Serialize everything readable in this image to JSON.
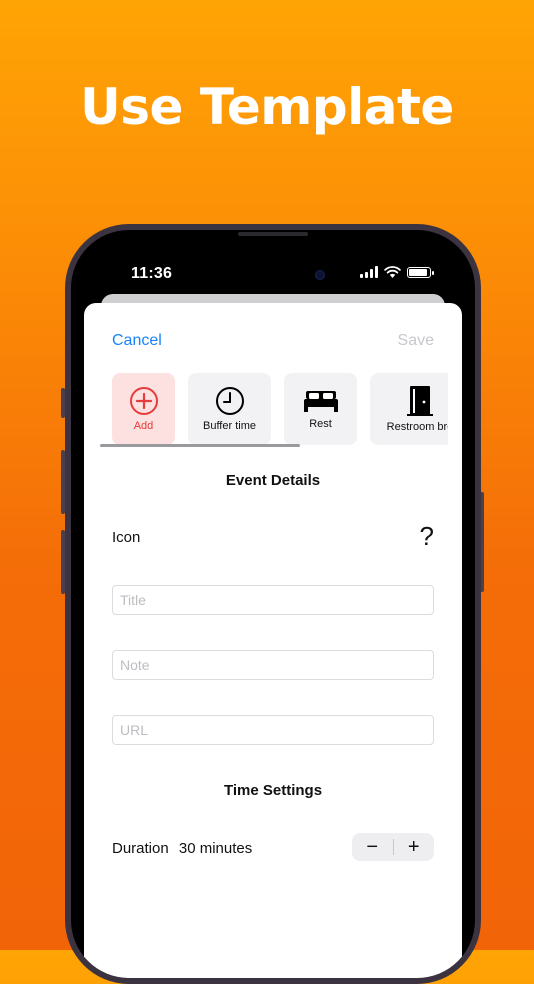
{
  "headline": "Use Template",
  "status_bar": {
    "time": "11:36"
  },
  "nav": {
    "cancel_label": "Cancel",
    "save_label": "Save"
  },
  "templates": [
    {
      "label": "Add",
      "icon": "plus-circle-icon",
      "color": "#e83b3b"
    },
    {
      "label": "Buffer time",
      "icon": "clock-icon"
    },
    {
      "label": "Rest",
      "icon": "bed-icon"
    },
    {
      "label": "Restroom bre",
      "icon": "door-icon"
    }
  ],
  "event_details": {
    "heading": "Event Details",
    "icon_label": "Icon",
    "icon_value": "?",
    "title_placeholder": "Title",
    "note_placeholder": "Note",
    "url_placeholder": "URL"
  },
  "time_settings": {
    "heading": "Time Settings",
    "duration_label": "Duration",
    "duration_value": "30 minutes",
    "decrement_label": "−",
    "increment_label": "+"
  },
  "colors": {
    "accent": "#1a82f8",
    "background_top": "#ffa405",
    "background_bottom": "#f26408",
    "add_tile": "#fde1e1"
  }
}
